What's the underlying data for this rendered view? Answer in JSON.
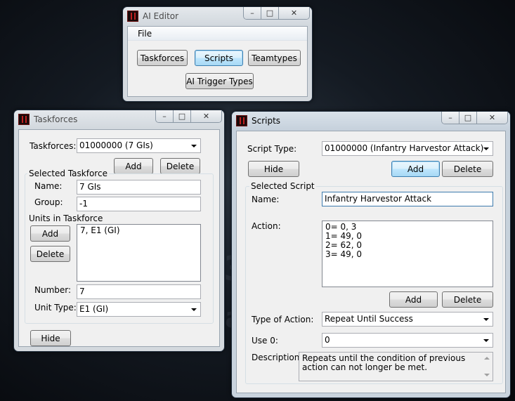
{
  "ai_editor": {
    "title": "AI Editor",
    "menu_file": "File",
    "btn_taskforces": "Taskforces",
    "btn_scripts": "Scripts",
    "btn_teamtypes": "Teamtypes",
    "btn_ai_trigger_types": "AI Trigger Types"
  },
  "taskforces": {
    "title": "Taskforces",
    "taskforces_label": "Taskforces:",
    "taskforces_value": "01000000 (7 GIs)",
    "add_label": "Add",
    "delete_label": "Delete",
    "group_title": "Selected Taskforce",
    "name_label": "Name:",
    "name_value": "7 GIs",
    "group_label": "Group:",
    "group_value": "-1",
    "units_label": "Units in Taskforce",
    "units_add_label": "Add",
    "units_delete_label": "Delete",
    "units": [
      "7, E1 (GI)"
    ],
    "number_label": "Number:",
    "number_value": "7",
    "unit_type_label": "Unit Type:",
    "unit_type_value": "E1 (GI)",
    "hide_label": "Hide"
  },
  "scripts": {
    "title": "Scripts",
    "script_type_label": "Script Type:",
    "script_type_value": "01000000 (Infantry Harvestor Attack)",
    "hide_label": "Hide",
    "add_label": "Add",
    "delete_label": "Delete",
    "group_title": "Selected Script",
    "name_label": "Name:",
    "name_value": "Infantry Harvestor Attack",
    "action_label": "Action:",
    "actions": [
      "0= 0, 3",
      "1= 49, 0",
      "2= 62, 0",
      "3= 49, 0"
    ],
    "action_add_label": "Add",
    "action_delete_label": "Delete",
    "type_of_action_label": "Type of Action:",
    "type_of_action_value": "Repeat Until Success",
    "use0_label": "Use 0:",
    "use0_value": "0",
    "description_label": "Description:",
    "description_value": "Repeats until the condition of previous action can not longer be met."
  },
  "window_controls": {
    "minimize": "–",
    "maximize": "□",
    "close": "✕"
  }
}
